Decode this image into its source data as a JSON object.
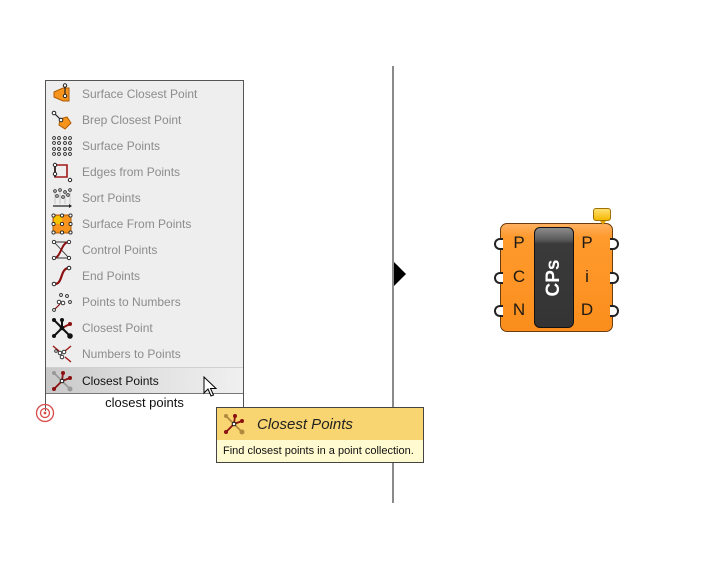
{
  "menu": {
    "items": [
      {
        "label": "Surface Closest Point",
        "icon": "surface-closest-point-icon"
      },
      {
        "label": "Brep Closest Point",
        "icon": "brep-closest-point-icon"
      },
      {
        "label": "Surface Points",
        "icon": "surface-points-icon"
      },
      {
        "label": "Edges from Points",
        "icon": "edges-from-points-icon"
      },
      {
        "label": "Sort Points",
        "icon": "sort-points-icon"
      },
      {
        "label": "Surface From Points",
        "icon": "surface-from-points-icon"
      },
      {
        "label": "Control Points",
        "icon": "control-points-icon"
      },
      {
        "label": "End Points",
        "icon": "end-points-icon"
      },
      {
        "label": "Points to Numbers",
        "icon": "points-to-numbers-icon"
      },
      {
        "label": "Closest Point",
        "icon": "closest-point-icon"
      },
      {
        "label": "Numbers to Points",
        "icon": "numbers-to-points-icon"
      },
      {
        "label": "Closest Points",
        "icon": "closest-points-icon",
        "active": true
      }
    ]
  },
  "search": {
    "value": "closest points"
  },
  "tooltip": {
    "title": "Closest Points",
    "description": "Find closest points in a point collection."
  },
  "component": {
    "nickname": "CPs",
    "inputs": [
      "P",
      "C",
      "N"
    ],
    "outputs": [
      "P",
      "i",
      "D"
    ]
  },
  "colors": {
    "component_orange": "#fb8e1c",
    "tooltip_header": "#f8d570",
    "tooltip_body": "#fffad0",
    "icon_red": "#a01818"
  }
}
